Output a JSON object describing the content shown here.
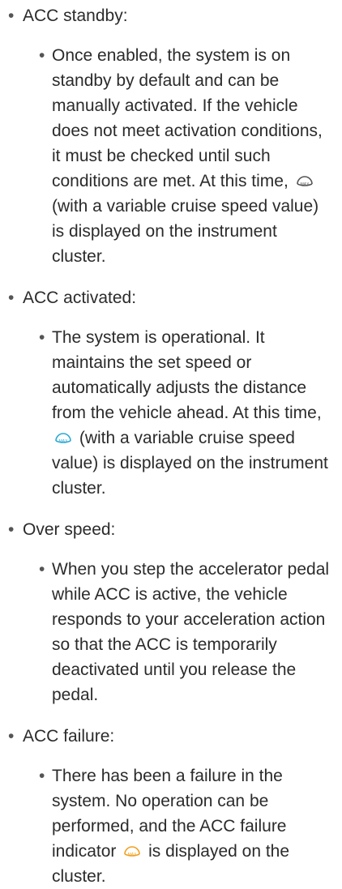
{
  "doc": {
    "bullet_char": "•",
    "standby": {
      "title": "ACC standby:",
      "desc_part1": "Once enabled, the system is on standby by default and can be manually activated. If the vehicle does not meet activation conditions, it must be checked until such conditions are met. At this time,",
      "desc_part2": "(with a variable cruise speed value) is displayed on the instrument cluster."
    },
    "activated": {
      "title": "ACC activated:",
      "desc_part1": "The system is operational. It maintains the set speed or automatically adjusts the distance from the vehicle ahead. At this time,",
      "desc_part2": "(with a variable cruise speed value) is displayed on the instrument cluster."
    },
    "overspeed": {
      "title": "Over speed:",
      "desc": "When you step the accelerator pedal while ACC is active, the vehicle responds to your acceleration action so that the ACC is temporarily deactivated until you release the pedal."
    },
    "failure": {
      "title": "ACC failure:",
      "desc_part1": "There has been a failure in the system. No operation can be performed, and the ACC failure indicator",
      "desc_part2": "is displayed on the cluster."
    }
  },
  "icons": {
    "standby_icon": "acc-standby-icon",
    "active_icon": "acc-active-icon",
    "failure_icon": "acc-failure-icon"
  },
  "colors": {
    "standby_icon": "#555555",
    "active_icon": "#2aa9d6",
    "failure_icon": "#f0a020"
  }
}
